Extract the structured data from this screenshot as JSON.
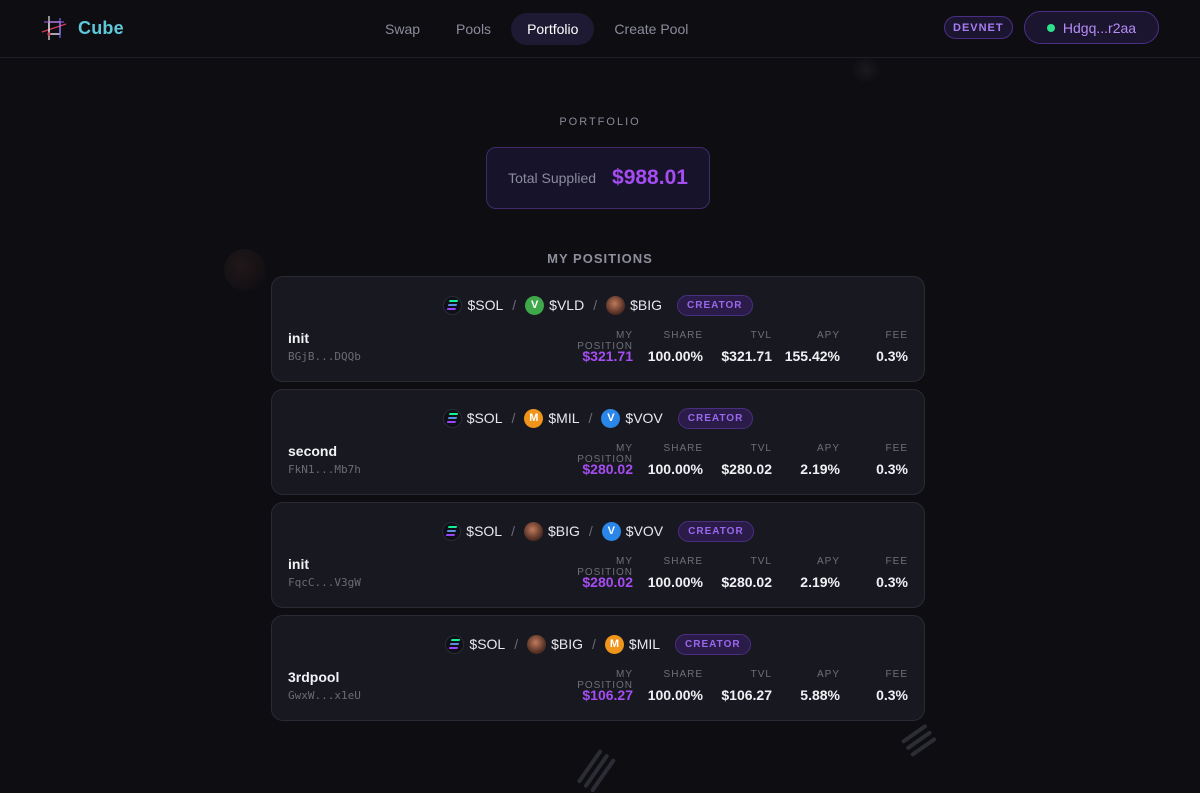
{
  "header": {
    "brand": "Cube",
    "nav": [
      "Swap",
      "Pools",
      "Portfolio",
      "Create Pool"
    ],
    "active_nav": "Portfolio",
    "network": "DEVNET",
    "wallet": "Hdgq...r2aa"
  },
  "portfolio": {
    "label": "PORTFOLIO",
    "total_label": "Total Supplied",
    "total_value": "$988.01"
  },
  "positions_title": "MY POSITIONS",
  "stat_labels": {
    "my_position": "MY POSITION",
    "share": "SHARE",
    "tvl": "TVL",
    "apy": "APY",
    "fee": "FEE"
  },
  "creator_label": "CREATOR",
  "separator": "/",
  "positions": [
    {
      "tokens": [
        {
          "symbol": "$SOL",
          "icon": "sol",
          "letter": ""
        },
        {
          "symbol": "$VLD",
          "icon": "vld",
          "letter": "V"
        },
        {
          "symbol": "$BIG",
          "icon": "big",
          "letter": ""
        }
      ],
      "name": "init",
      "address": "BGjB...DQQb",
      "my_position": "$321.71",
      "share": "100.00%",
      "tvl": "$321.71",
      "apy": "155.42%",
      "fee": "0.3%"
    },
    {
      "tokens": [
        {
          "symbol": "$SOL",
          "icon": "sol",
          "letter": ""
        },
        {
          "symbol": "$MIL",
          "icon": "mil",
          "letter": "M"
        },
        {
          "symbol": "$VOV",
          "icon": "vov",
          "letter": "V"
        }
      ],
      "name": "second",
      "address": "FkN1...Mb7h",
      "my_position": "$280.02",
      "share": "100.00%",
      "tvl": "$280.02",
      "apy": "2.19%",
      "fee": "0.3%"
    },
    {
      "tokens": [
        {
          "symbol": "$SOL",
          "icon": "sol",
          "letter": ""
        },
        {
          "symbol": "$BIG",
          "icon": "big",
          "letter": ""
        },
        {
          "symbol": "$VOV",
          "icon": "vov",
          "letter": "V"
        }
      ],
      "name": "init",
      "address": "FqcC...V3gW",
      "my_position": "$280.02",
      "share": "100.00%",
      "tvl": "$280.02",
      "apy": "2.19%",
      "fee": "0.3%"
    },
    {
      "tokens": [
        {
          "symbol": "$SOL",
          "icon": "sol",
          "letter": ""
        },
        {
          "symbol": "$BIG",
          "icon": "big",
          "letter": ""
        },
        {
          "symbol": "$MIL",
          "icon": "mil",
          "letter": "M"
        }
      ],
      "name": "3rdpool",
      "address": "GwxW...x1eU",
      "my_position": "$106.27",
      "share": "100.00%",
      "tvl": "$106.27",
      "apy": "5.88%",
      "fee": "0.3%"
    }
  ]
}
